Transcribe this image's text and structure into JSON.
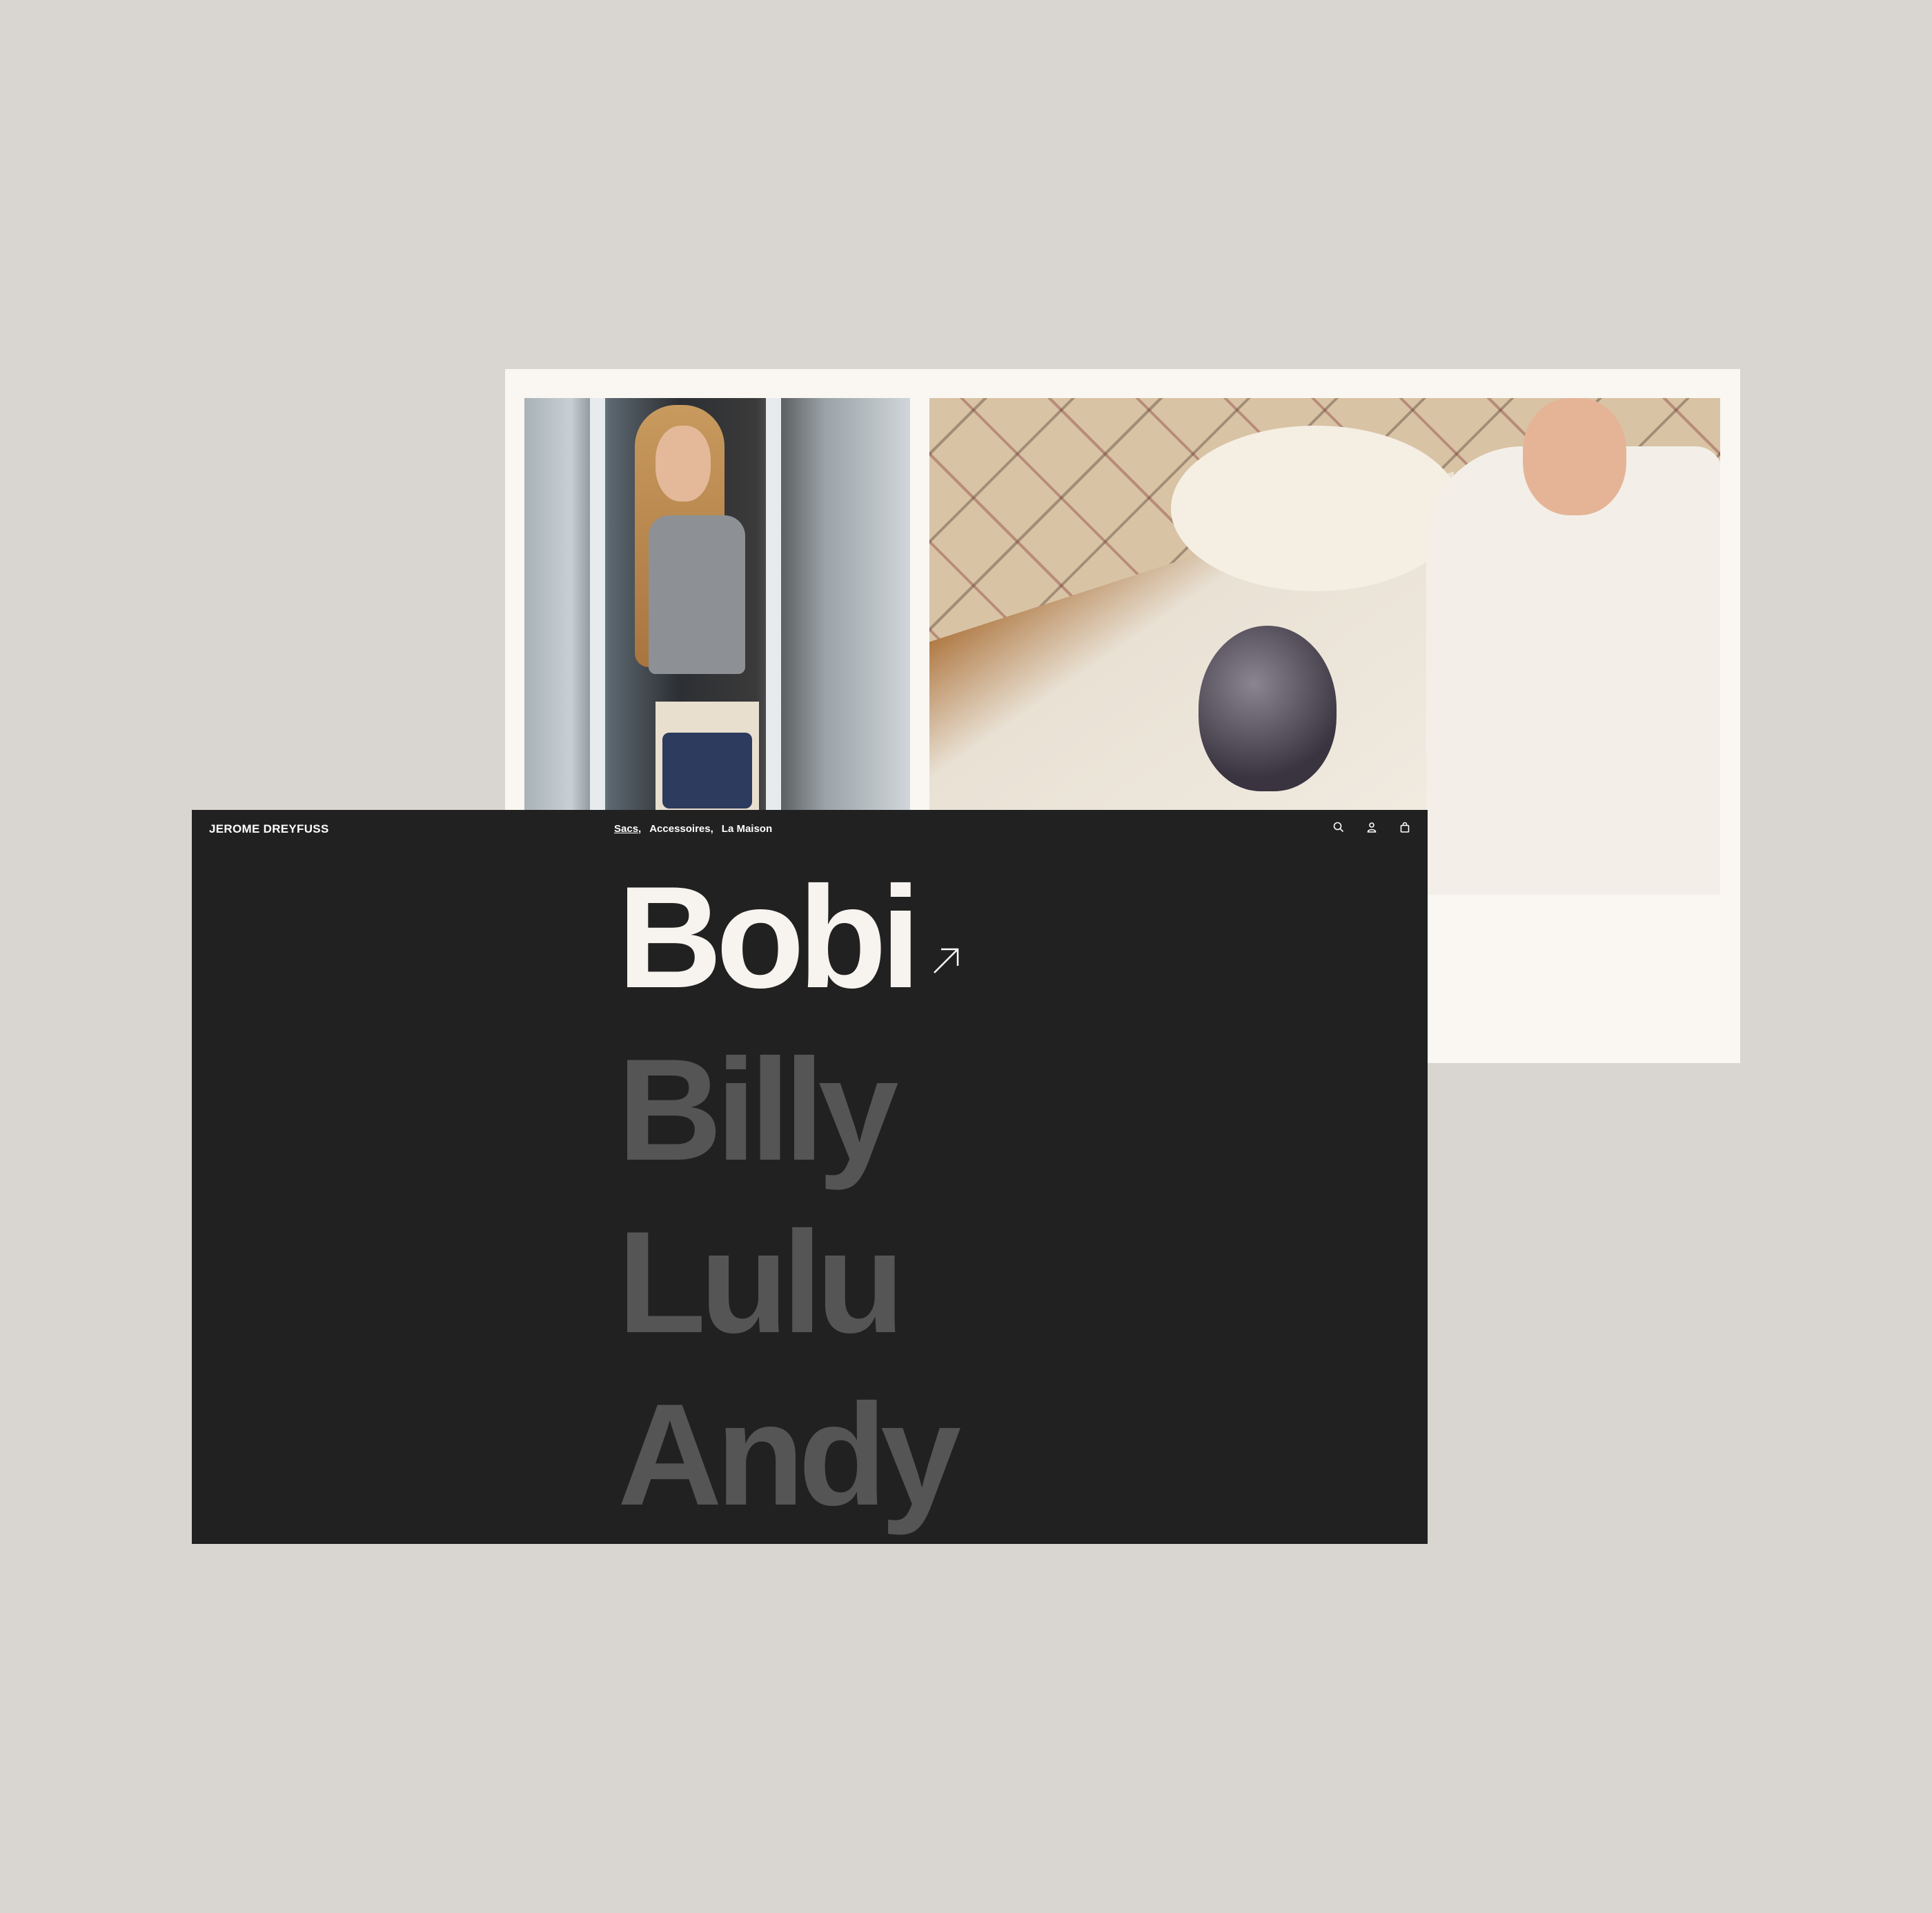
{
  "brand": "JEROME DREYFUSS",
  "nav": {
    "items": [
      {
        "label": "Sacs,",
        "active": true
      },
      {
        "label": "Accessoires,",
        "active": false
      },
      {
        "label": "La Maison",
        "active": false
      }
    ]
  },
  "icons": [
    "search-icon",
    "account-icon",
    "bag-icon"
  ],
  "models": [
    {
      "label": "Bobi",
      "active": true
    },
    {
      "label": "Billy",
      "active": false
    },
    {
      "label": "Lulu",
      "active": false
    },
    {
      "label": "Andy",
      "active": false
    }
  ],
  "colors": {
    "background": "#d9d6d1",
    "dark_panel": "#212121",
    "inactive_text": "#555555",
    "active_text": "#f7f3ee",
    "photo_card": "#faf7f2"
  }
}
